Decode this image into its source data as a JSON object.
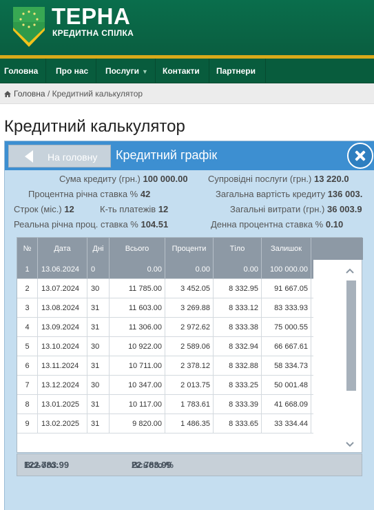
{
  "header": {
    "brand": "ТЕРНА",
    "subtitle": "КРЕДИТНА СПІЛКА"
  },
  "nav": [
    {
      "label": "Головна"
    },
    {
      "label": "Про нас"
    },
    {
      "label": "Послуги",
      "has_dropdown": true
    },
    {
      "label": "Контакти"
    },
    {
      "label": "Партнери"
    }
  ],
  "breadcrumb": {
    "home": "Головна",
    "separator": "/",
    "current": "Кредитний калькулятор"
  },
  "page_title": "Кредитний калькулятор",
  "panel": {
    "home_button": "На головну",
    "title": "Кредитний графік",
    "summary": {
      "loan_amount_label": "Сума кредиту (грн.)",
      "loan_amount": "100 000.00",
      "rate_label": "Процентна річна ставка %",
      "rate": "42",
      "term_label": "Строк (міс.)",
      "term": "12",
      "payments_label": "К-ть платежів",
      "payments": "12",
      "real_rate_label": "Реальна річна проц. ставка %",
      "real_rate": "104.51",
      "services_label": "Супровідні послуги (грн.)",
      "services": "13 220.0",
      "total_cost_label": "Загальна вартість кредиту",
      "total_cost": "136 003.",
      "total_expenses_label": "Загальні витрати (грн.)",
      "total_expenses": "36 003.9",
      "daily_rate_label": "Денна процентна ставка %",
      "daily_rate": "0.10"
    },
    "table": {
      "columns": [
        "№",
        "Дата",
        "Дні",
        "Всього",
        "Проценти",
        "Тіло",
        "Залишок"
      ],
      "rows": [
        [
          "1",
          "13.06.2024",
          "0",
          "0.00",
          "0.00",
          "0.00",
          "100 000.00"
        ],
        [
          "2",
          "13.07.2024",
          "30",
          "11 785.00",
          "3 452.05",
          "8 332.95",
          "91 667.05"
        ],
        [
          "3",
          "13.08.2024",
          "31",
          "11 603.00",
          "3 269.88",
          "8 333.12",
          "83 333.93"
        ],
        [
          "4",
          "13.09.2024",
          "31",
          "11 306.00",
          "2 972.62",
          "8 333.38",
          "75 000.55"
        ],
        [
          "5",
          "13.10.2024",
          "30",
          "10 922.00",
          "2 589.06",
          "8 332.94",
          "66 667.61"
        ],
        [
          "6",
          "13.11.2024",
          "31",
          "10 711.00",
          "2 378.12",
          "8 332.88",
          "58 334.73"
        ],
        [
          "7",
          "13.12.2024",
          "30",
          "10 347.00",
          "2 013.75",
          "8 333.25",
          "50 001.48"
        ],
        [
          "8",
          "13.01.2025",
          "31",
          "10 117.00",
          "1 783.61",
          "8 333.39",
          "41 668.09"
        ],
        [
          "9",
          "13.02.2025",
          "31",
          "9 820.00",
          "1 486.35",
          "8 333.65",
          "33 334.44"
        ]
      ]
    },
    "totals": {
      "total_label": "Всього:",
      "total": "122 783.99",
      "total_pct_label": "Всього %",
      "total_pct": "22 783.99"
    }
  },
  "colors": {
    "header_green": "#0a6e4c",
    "accent_gold": "#d9a91a",
    "panel_blue": "#3d8fd1",
    "panel_bg": "#c5def0",
    "table_header": "#8d99a5"
  }
}
